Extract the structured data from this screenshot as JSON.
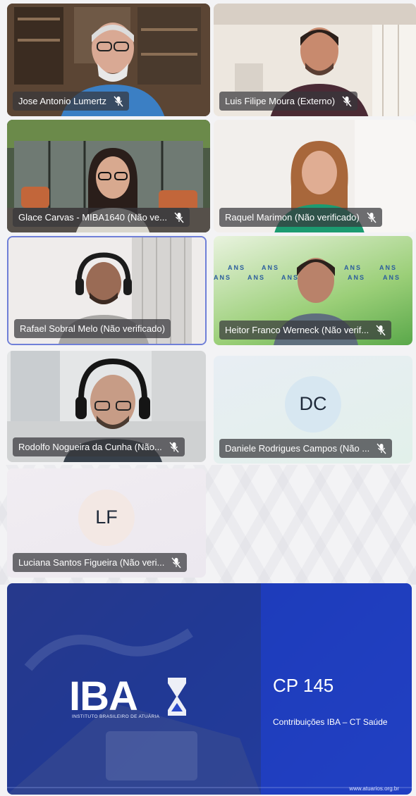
{
  "participants": [
    {
      "name": "Jose Antonio Lumertz",
      "muted": true
    },
    {
      "name": "Luis Filipe Moura (Externo)",
      "muted": true
    },
    {
      "name": "Glace Carvas - MIBA1640 (Não ve...",
      "muted": true
    },
    {
      "name": "Raquel Marimon (Não verificado)",
      "muted": true
    },
    {
      "name": "Rafael Sobral Melo (Não verificado)",
      "muted": false
    },
    {
      "name": "Heitor Franco Werneck (Não verif...",
      "muted": true
    },
    {
      "name": "Rodolfo Nogueira da Cunha (Não...",
      "muted": true
    },
    {
      "name": "Daniele Rodrigues Campos (Não ...",
      "muted": true,
      "initials": "DC"
    },
    {
      "name": "Luciana Santos Figueira (Não veri...",
      "muted": true,
      "initials": "LF"
    }
  ],
  "banner_text": "ANS",
  "slide": {
    "logo_text": "IBA",
    "logo_subtitle": "INSTITUTO BRASILEIRO DE ATUÁRIA",
    "title": "CP 145",
    "subtitle": "Contribuições IBA – CT Saúde",
    "url": "www.atuarios.org.br"
  },
  "colors": {
    "chip_bg": "#37373c",
    "slide_bg": "#1f3fb0",
    "avatar_dc": "#d7e7f1",
    "avatar_lf": "#f3e8e4"
  }
}
